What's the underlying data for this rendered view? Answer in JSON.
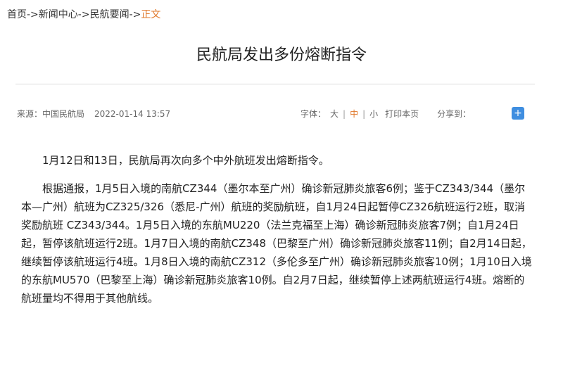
{
  "breadcrumb": {
    "home": "首页",
    "news": "新闻中心",
    "section": "民航要闻",
    "current": "正文",
    "separator": "->"
  },
  "article": {
    "title": "民航局发出多份熔断指令",
    "source": "来源：中国民航局",
    "date": "2022-01-14 13:57",
    "paragraphs": [
      "1月12日和13日，民航局再次向多个中外航班发出熔断指令。",
      "根据通报，1月5日入境的南航CZ344（墨尔本至广州）确诊新冠肺炎旅客6例；鉴于CZ343/344（墨尔本—广州）航班为CZ325/326（悉尼-广州）航班的奖励航班，自1月24日起暂停CZ326航班运行2班，取消奖励航班 CZ343/344。1月5日入境的东航MU220（法兰克福至上海）确诊新冠肺炎旅客7例；自1月24日起，暂停该航班运行2班。1月7日入境的南航CZ348（巴黎至广州）确诊新冠肺炎旅客11例；自2月14日起，继续暂停该航班运行4班。1月8日入境的南航CZ312（多伦多至广州）确诊新冠肺炎旅客10例；1月10日入境的东航MU570（巴黎至上海）确诊新冠肺炎旅客10例。自2月7日起，继续暂停上述两航班运行4班。熔断的航班量均不得用于其他航线。"
    ]
  },
  "tools": {
    "font_label": "字体：",
    "large": "大",
    "medium": "中",
    "small": "小",
    "divider": "|",
    "print": "打印本页",
    "share": "分享到："
  },
  "icons": {
    "share": "plus-icon"
  },
  "colors": {
    "active": "#e0782a",
    "share_icon_bg": "#3f8ee0"
  }
}
